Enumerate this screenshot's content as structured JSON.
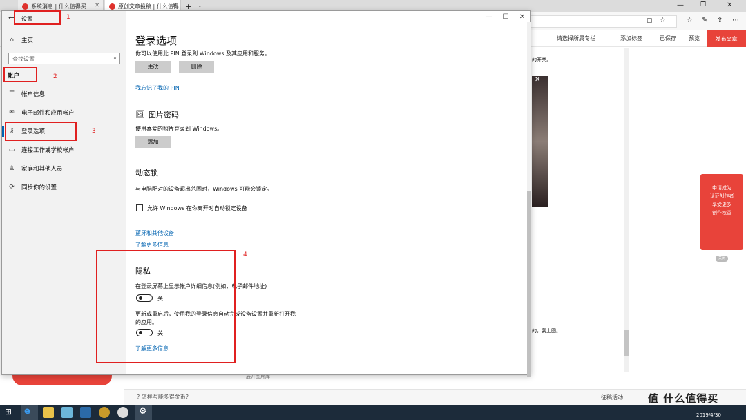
{
  "browser": {
    "tabs": [
      {
        "label": "系统消息 | 什么值得买"
      },
      {
        "label": "原创文章投稿 | 什么值得"
      }
    ],
    "pagebar": [
      "请选择所属专栏",
      "添加标签",
      "已保存",
      "预览"
    ],
    "publish_label": "发布文章",
    "editor_text1": "的开关。",
    "editor_text2": "的，我上图。",
    "editor_caption": "展开图片库",
    "footer_text": "怎样写能多得金币?",
    "footer_right": "征稿活动",
    "promo_lines": [
      "申请成为",
      "认证创作者",
      "享受更多",
      "创作权益"
    ],
    "promo_close": "关闭",
    "watermark": "值 什么值得买"
  },
  "settings": {
    "window_title": "设置",
    "sidebar": {
      "home": "主页",
      "search_placeholder": "查找设置",
      "section": "帐户",
      "items": [
        {
          "label": "帐户信息",
          "icon": "person-card-icon"
        },
        {
          "label": "电子邮件和应用帐户",
          "icon": "mail-icon"
        },
        {
          "label": "登录选项",
          "icon": "key-icon"
        },
        {
          "label": "连接工作或学校帐户",
          "icon": "briefcase-icon"
        },
        {
          "label": "家庭和其他人员",
          "icon": "people-icon"
        },
        {
          "label": "同步你的设置",
          "icon": "sync-icon"
        }
      ]
    },
    "main": {
      "page_title": "登录选项",
      "pin_desc": "你可以使用此 PIN 登录到 Windows 及其应用和服务。",
      "pin_change": "更改",
      "pin_remove": "删除",
      "pin_forgot": "我忘记了我的 PIN",
      "picture_title": "图片密码",
      "picture_desc": "使用喜爱的照片登录到 Windows。",
      "picture_add": "添加",
      "dynamic_title": "动态锁",
      "dynamic_desc": "与电脑配对的设备超出范围时，Windows 可能会锁定。",
      "dynamic_checkbox": "允许 Windows 在你离开时自动锁定设备",
      "bt_link": "蓝牙和其他设备",
      "learn_more1": "了解更多信息",
      "privacy_title": "隐私",
      "privacy_desc1": "在登录屏幕上显示帐户详细信息(例如，电子邮件地址)",
      "toggle1_label": "关",
      "privacy_desc2a": "更新或重启后，使用我的登录信息自动完成设备设置并重新打开我",
      "privacy_desc2b": "的应用。",
      "toggle2_label": "关",
      "learn_more2": "了解更多信息"
    }
  },
  "annotations": [
    "1",
    "2",
    "3",
    "4"
  ],
  "taskbar": {
    "time": "",
    "date": "2019/4/30"
  }
}
